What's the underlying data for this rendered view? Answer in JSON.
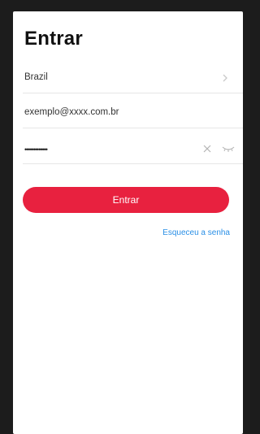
{
  "page": {
    "title": "Entrar"
  },
  "form": {
    "country_value": "Brazil",
    "email_value": "exemplo@xxxx.com.br",
    "password_masked": "•••••••••••••",
    "submit_label": "Entrar",
    "forgot_label": "Esqueceu a senha"
  },
  "icons": {
    "country_chevron": "chevron-right-icon",
    "clear": "close-icon",
    "toggle_visibility": "eye-closed-icon"
  },
  "colors": {
    "accent": "#e8213f",
    "link": "#2a8fe6",
    "background": "#ffffff",
    "frame": "#1c1c1c"
  }
}
